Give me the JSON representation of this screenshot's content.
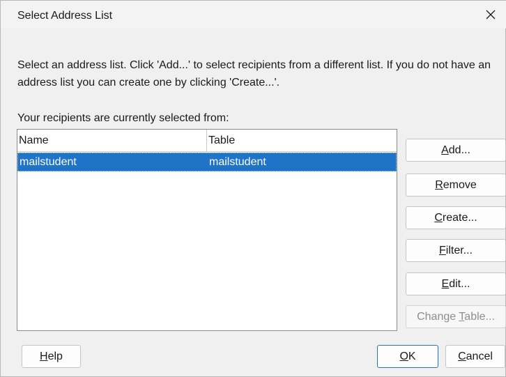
{
  "window": {
    "title": "Select Address List"
  },
  "intro": {
    "text": "Select an address list. Click 'Add...' to select recipients from a different list. If you do not have an address list you can create one by clicking 'Create...'."
  },
  "current_label": "Your recipients are currently selected from:",
  "list": {
    "columns": [
      "Name",
      "Table"
    ],
    "rows": [
      {
        "name": "mailstudent",
        "table": "mailstudent",
        "selected": true
      }
    ]
  },
  "side_buttons": [
    {
      "pre": "",
      "mn": "A",
      "post": "dd...",
      "enabled": true
    },
    {
      "pre": "",
      "mn": "R",
      "post": "emove",
      "enabled": true
    },
    {
      "pre": "",
      "mn": "C",
      "post": "reate...",
      "enabled": true
    },
    {
      "pre": "",
      "mn": "F",
      "post": "ilter...",
      "enabled": true
    },
    {
      "pre": "",
      "mn": "E",
      "post": "dit...",
      "enabled": true
    },
    {
      "pre": "Change ",
      "mn": "T",
      "post": "able...",
      "enabled": false
    }
  ],
  "footer": {
    "help": {
      "pre": "",
      "mn": "H",
      "post": "elp"
    },
    "ok": {
      "pre": "",
      "mn": "O",
      "post": "K"
    },
    "cancel": {
      "pre": "",
      "mn": "C",
      "post": "ancel"
    }
  },
  "icons": {
    "close": "close-icon"
  },
  "colors": {
    "selection": "#1f74c8",
    "default_button_border": "#1f74c8"
  }
}
